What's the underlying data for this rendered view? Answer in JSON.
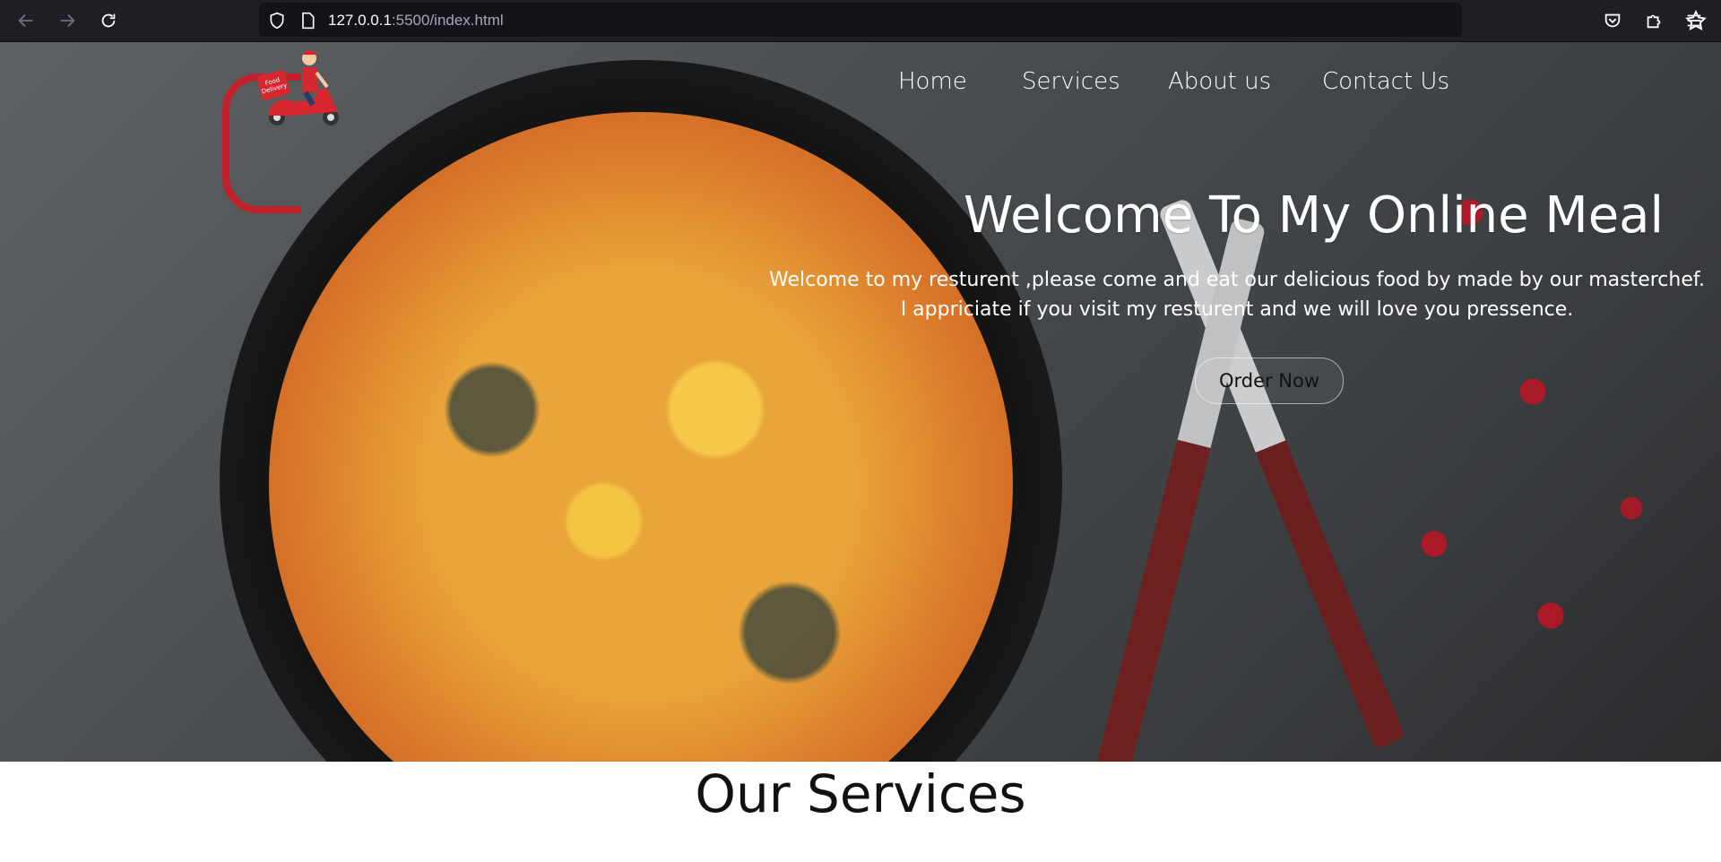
{
  "browser": {
    "url_host": "127.0.0.1",
    "url_rest": ":5500/index.html"
  },
  "nav": {
    "items": [
      {
        "label": "Home"
      },
      {
        "label": "Services"
      },
      {
        "label": "About us"
      },
      {
        "label": "Contact Us"
      }
    ]
  },
  "hero": {
    "title": "Welcome To My Online Meal",
    "line1": "Welcome to my resturent ,please come and eat our delicious food by made by our masterchef.",
    "line2": "I appriciate if you visit my resturent and we will love you pressence.",
    "button_label": "Order Now"
  },
  "services": {
    "title": "Our Services"
  },
  "logo": {
    "label_line1": "Food",
    "label_line2": "Delivery"
  },
  "colors": {
    "chrome_bg": "#1f1e25",
    "hero_text": "#ffffff",
    "accent_red": "#c3202b"
  }
}
